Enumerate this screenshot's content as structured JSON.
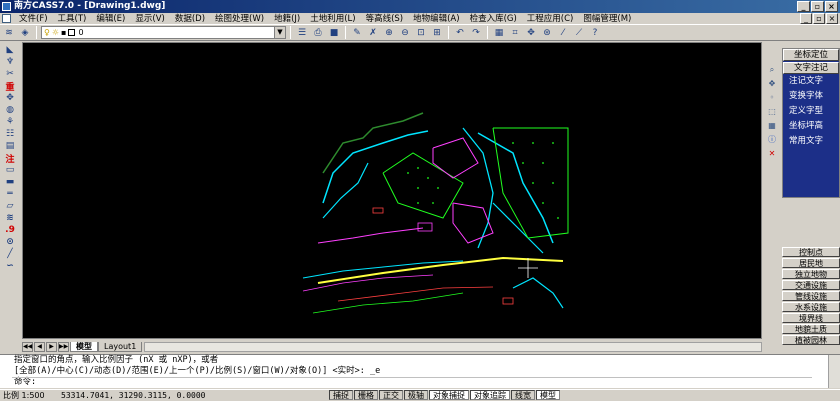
{
  "window": {
    "title": "南方CASS7.0 - [Drawing1.dwg]"
  },
  "menu": [
    "文件(F)",
    "工具(T)",
    "编辑(E)",
    "显示(V)",
    "数据(D)",
    "绘图处理(W)",
    "地籍(J)",
    "土地利用(L)",
    "等高线(S)",
    "地物编辑(A)",
    "检查入库(G)",
    "工程应用(C)",
    "图幅管理(M)"
  ],
  "toolbar": {
    "layer_value": "0"
  },
  "left_tools": [
    "重",
    "注",
    ".9",
    "⊙"
  ],
  "tabs": {
    "model": "模型",
    "layout": "Layout1"
  },
  "right_panel": {
    "header": "坐标定位",
    "header2": "文字注记",
    "items": [
      "注记文字",
      "变换字体",
      "定义字型",
      "坐标坪高",
      "常用文字"
    ],
    "categories": [
      "控制点",
      "居民地",
      "独立地物",
      "交通设施",
      "管线设施",
      "水系设施",
      "境界线",
      "地貌土质",
      "植被园林"
    ]
  },
  "command": {
    "line1": "指定窗口的角点，输入比例因子 (nX 或 nXP)，或者",
    "line2": "[全部(A)/中心(C)/动态(D)/范围(E)/上一个(P)/比例(S)/窗口(W)/对象(O)] <实时>: _e",
    "prompt": "命令:"
  },
  "status": {
    "scale": "比例 1:500",
    "coords": "53314.7041, 31290.3115, 0.0000",
    "buttons": [
      {
        "label": "捕捉",
        "on": false
      },
      {
        "label": "栅格",
        "on": false
      },
      {
        "label": "正交",
        "on": false
      },
      {
        "label": "极轴",
        "on": false
      },
      {
        "label": "对象捕捉",
        "on": true
      },
      {
        "label": "对象追踪",
        "on": true
      },
      {
        "label": "线宽",
        "on": false
      },
      {
        "label": "模型",
        "on": true
      }
    ]
  }
}
